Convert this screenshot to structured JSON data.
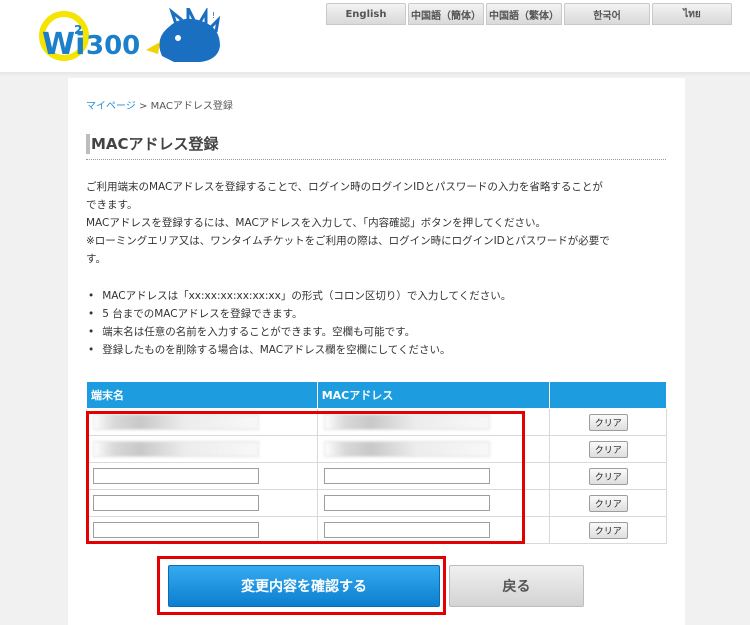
{
  "header": {
    "logo_text": "Wi²300",
    "languages": [
      {
        "label": "English",
        "w": 80
      },
      {
        "label": "中国語（簡体）",
        "w": 76
      },
      {
        "label": "中国語（繁体）",
        "w": 76
      },
      {
        "label": "한국어",
        "w": 86
      },
      {
        "label": "ไทย",
        "w": 80
      }
    ]
  },
  "breadcrumb": {
    "home": "マイページ",
    "separator": ">",
    "current": "MACアドレス登録"
  },
  "page_title": "MACアドレス登録",
  "description": [
    "ご利用端末のMACアドレスを登録することで、ログイン時のログインIDとパスワードの入力を省略することが",
    "できます。",
    "MACアドレスを登録するには、MACアドレスを入力して、「内容確認」ボタンを押してください。",
    "※ローミングエリア又は、ワンタイムチケットをご利用の際は、ログイン時にログインIDとパスワードが必要で",
    "す。"
  ],
  "bullets": [
    "MACアドレスは「xx:xx:xx:xx:xx:xx」の形式（コロン区切り）で入力してください。",
    "5 台までのMACアドレスを登録できます。",
    "端末名は任意の名前を入力することができます。空欄も可能です。",
    "登録したものを削除する場合は、MACアドレス欄を空欄にしてください。"
  ],
  "table": {
    "headers": [
      "端末名",
      "MACアドレス",
      ""
    ],
    "clear_label": "クリア",
    "rows": [
      {
        "name": "",
        "mac": "",
        "blurred": true
      },
      {
        "name": "",
        "mac": "",
        "blurred": true
      },
      {
        "name": "",
        "mac": "",
        "blurred": false
      },
      {
        "name": "",
        "mac": "",
        "blurred": false
      },
      {
        "name": "",
        "mac": "",
        "blurred": false
      }
    ]
  },
  "buttons": {
    "confirm": "変更内容を確認する",
    "back": "戻る"
  },
  "colors": {
    "accent": "#1d9de0",
    "highlight": "#e30000",
    "link": "#2a8fd6"
  }
}
